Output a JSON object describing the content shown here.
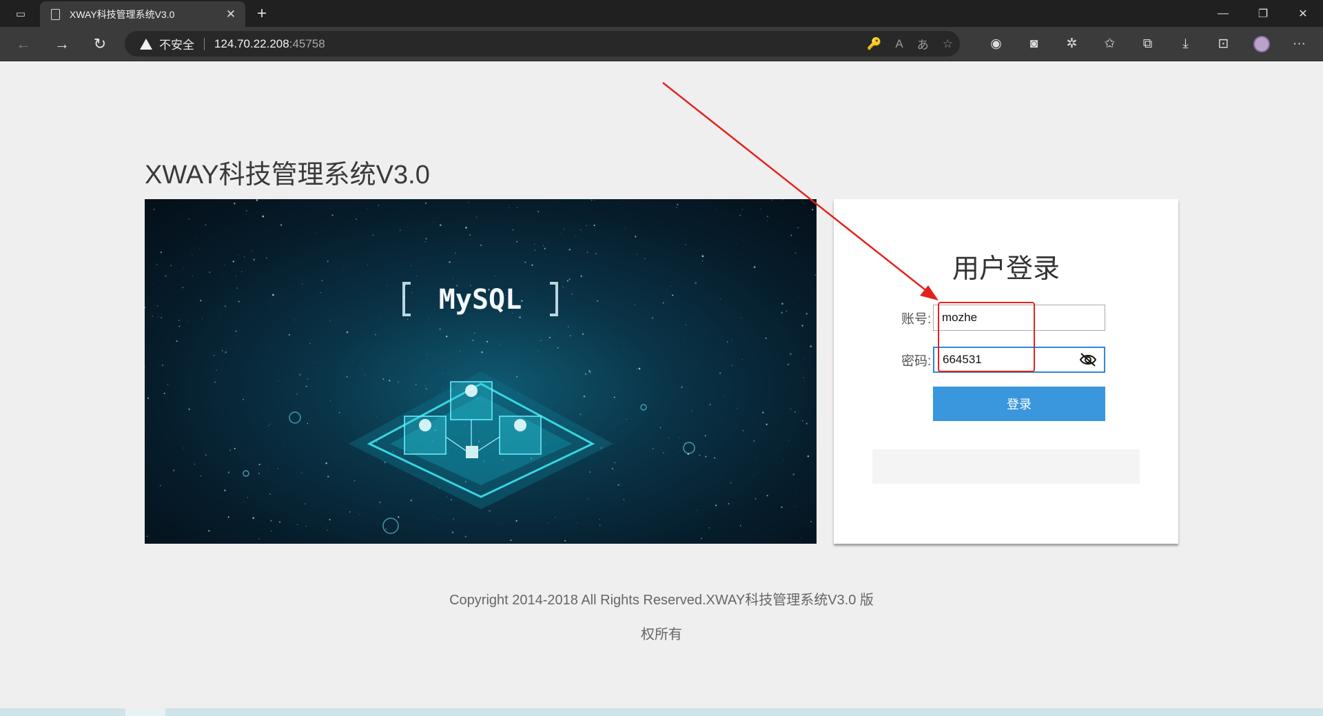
{
  "browser": {
    "tab_title": "XWAY科技管理系统V3.0",
    "tab_close": "✕",
    "new_tab": "+",
    "insecure_label": "不安全",
    "url_host": "124.70.22.208",
    "url_port": ":45758",
    "back": "←",
    "forward": "→",
    "reload": "↻",
    "minimize": "—",
    "restore": "❐",
    "close": "✕",
    "omnibox_icons": [
      "🔑",
      "A",
      "あ",
      "☆"
    ],
    "toolbar_icons": [
      "extension",
      "collections",
      "puzzle",
      "favorites",
      "copilot",
      "download",
      "screenshot"
    ],
    "more": "···"
  },
  "page": {
    "title": "XWAY科技管理系统V3.0",
    "banner_logo": "MySQL",
    "login": {
      "heading": "用户登录",
      "username_label": "账号:",
      "username_value": "mozhe",
      "password_label": "密码:",
      "password_value": "664531",
      "submit_label": "登录"
    },
    "copyright_line1": "Copyright 2014-2018 All Rights Reserved.XWAY科技管理系统V3.0 版",
    "copyright_line2": "权所有"
  },
  "colors": {
    "accent_button": "#3a96dd",
    "annotation": "#e3221c",
    "focus_border": "#2c87d6"
  }
}
